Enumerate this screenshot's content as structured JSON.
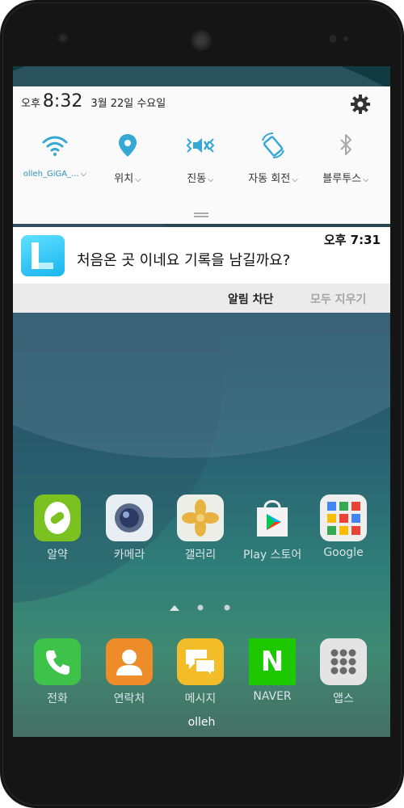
{
  "status_panel": {
    "ampm": "오후",
    "time": "8:32",
    "date": "3월 22일 수요일"
  },
  "quick_toggles": [
    {
      "label": "olleh_GiGA_...",
      "icon": "wifi-icon",
      "caret": "⌵"
    },
    {
      "label": "위치",
      "icon": "location-icon",
      "caret": "⌵"
    },
    {
      "label": "진동",
      "icon": "vibrate-icon",
      "caret": "⌵"
    },
    {
      "label": "자동 회전",
      "icon": "rotate-icon",
      "caret": "⌵"
    },
    {
      "label": "블루투스",
      "icon": "bluetooth-icon",
      "caret": "⌵"
    }
  ],
  "notification": {
    "time": "오후 7:31",
    "text": "처음온 곳 이네요 기록을 남길까요?",
    "app_icon": "app-l-icon"
  },
  "notification_actions": {
    "block": "알림 차단",
    "clear_all": "모두 지우기"
  },
  "home_apps": [
    {
      "label": "알약",
      "icon": "alyac-icon"
    },
    {
      "label": "카메라",
      "icon": "camera-icon"
    },
    {
      "label": "갤러리",
      "icon": "gallery-icon"
    },
    {
      "label": "Play 스토어",
      "icon": "play-store-icon"
    },
    {
      "label": "Google",
      "icon": "google-folder-icon"
    }
  ],
  "dock_apps": [
    {
      "label": "전화",
      "icon": "phone-icon"
    },
    {
      "label": "연락처",
      "icon": "contacts-icon"
    },
    {
      "label": "메시지",
      "icon": "messages-icon"
    },
    {
      "label": "NAVER",
      "icon": "naver-icon",
      "glyph": "N"
    },
    {
      "label": "앱스",
      "icon": "apps-grid-icon"
    }
  ],
  "carrier": "olleh",
  "colors": {
    "accent_wifi_text": "#2a8fbd",
    "toggle_active": "#35a8d6",
    "notification_app": "#19b4ee",
    "naver_green": "#1ec800"
  }
}
